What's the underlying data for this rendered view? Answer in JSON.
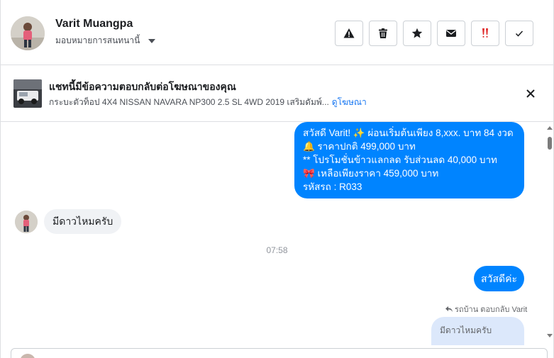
{
  "header": {
    "user_name": "Varit Muangpa",
    "assign_label": "มอบหมายการสนทนานี้",
    "actions": [
      {
        "icon": "warning-icon",
        "label": "Report"
      },
      {
        "icon": "trash-icon",
        "label": "Delete"
      },
      {
        "icon": "star-icon",
        "label": "Star"
      },
      {
        "icon": "envelope-icon",
        "label": "Mark unread"
      },
      {
        "icon": "double-exclamation-icon",
        "label": "Mark important"
      },
      {
        "icon": "check-icon",
        "label": "Done"
      }
    ]
  },
  "ad_banner": {
    "title": "แชทนี้มีข้อความตอบกลับต่อโฆษณาของคุณ",
    "subtitle": "กระบะตัวท็อป 4X4 NISSAN NAVARA NP300 2.5 SL 4WD 2019 เสริมดัมพ์...",
    "link": "ดูโฆษณา"
  },
  "messages": {
    "outgoing_promo": {
      "line1": "สวัสดี Varit! ✨  ผ่อนเริ่มต้นเพียง 8,xxx. บาท 84 งวด",
      "line2": "🔔 ราคาปกติ 499,000 บาท",
      "line3": "** โปรโมชั่นข้าวแลกลด รับส่วนลด 40,000 บาท",
      "line4": "🎀  เหลือเพียงราคา 459,000 บาท",
      "line5": " รหัสรถ : R033"
    },
    "incoming": "มีดาวไหมครับ",
    "timestamp": "07:58",
    "outgoing_hi": "สวัสดีค่ะ",
    "reply_label": "รถบ้าน ตอบกลับ Varit",
    "quoted": "มีดาวไหมครับ"
  },
  "colors": {
    "accent": "#0084ff",
    "link": "#1877f2",
    "incoming_bg": "#f0f2f5",
    "quote_bg": "#dce8fb",
    "important_red": "#e02d2d"
  }
}
